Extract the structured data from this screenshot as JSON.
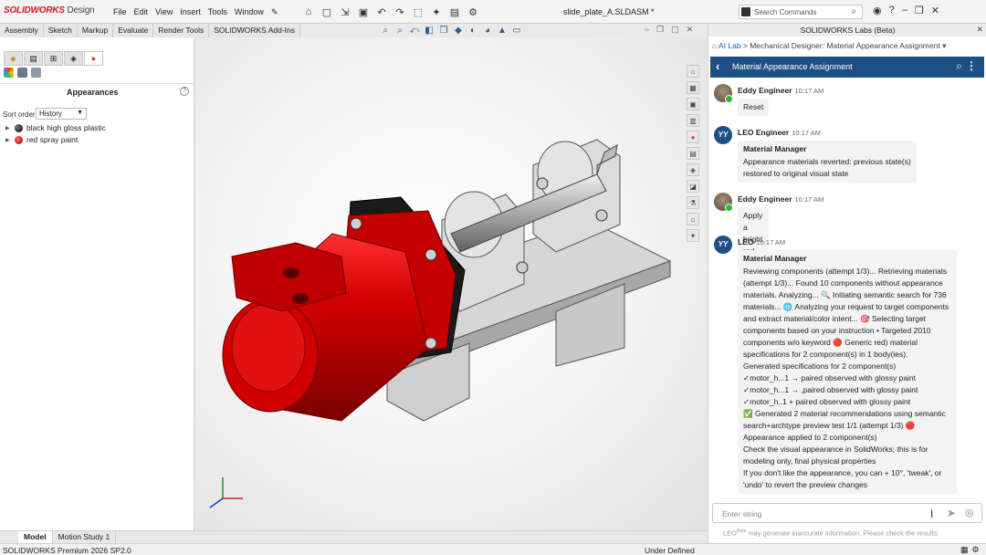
{
  "app": {
    "logo_brand": "SOLIDWORKS",
    "logo_product": "Design",
    "doc_title": "slide_plate_A.SLDASM *",
    "menu": [
      "File",
      "Edit",
      "View",
      "Insert",
      "Tools",
      "Window"
    ],
    "search_placeholder": "Search Commands"
  },
  "command_tabs": [
    "Assembly",
    "Sketch",
    "Markup",
    "Evaluate",
    "Render Tools",
    "SOLIDWORKS Add-Ins"
  ],
  "left_panel": {
    "title": "Appearances",
    "sort_label": "Sort order:",
    "sort_value": "History",
    "items": [
      {
        "label": "black high gloss plastic",
        "color": "#000000"
      },
      {
        "label": "red spray paint",
        "color": "#c00000"
      }
    ]
  },
  "bottom_tabs": [
    "Model",
    "Motion Study 1"
  ],
  "status": {
    "left": "SOLIDWORKS Premium 2026 SP2.0",
    "right": "Under Defined"
  },
  "right_panel": {
    "title": "SOLIDWORKS Labs (Beta)",
    "breadcrumb_root": "AI Lab",
    "breadcrumb_sep": ">",
    "breadcrumb_current": "Mechanical Designer: Material Appearance Assignment",
    "header_title": "Material Appearance Assignment",
    "messages": [
      {
        "author": "Eddy Engineer",
        "time": "10:17 AM",
        "text": "Reset"
      },
      {
        "author": "LEO Engineer",
        "time": "10:17 AM",
        "title": "Material Manager",
        "lines": [
          "Appearance materials reverted:  previous state(s)",
          "restored to original visual state"
        ]
      },
      {
        "author": "Eddy Engineer",
        "time": "10:17 AM",
        "text": "Apply a bright red paint color to the motor"
      },
      {
        "author": "LEO",
        "time": "10:17 AM",
        "title": "Material Manager",
        "lines": [
          "Reviewing components (attempt 1/3)... Retrieving materials",
          "(attempt 1/3)... Found 10 components without appearance",
          "materials. Analyzing... 🔍 Initiating semantic search for 736",
          "materials... 🌐 Analyzing your request to target components",
          "and extract material/color intent... 🎯 Selecting target",
          "components based on your instruction   • Targeted 2010",
          "components w/o keyword 🔴 Generic red) material",
          "specifications for 2 component(s) in 1 body(ies).",
          "Generated specifications for 2 component(s)",
          "✓motor_h...1     →    paired observed with glossy paint",
          "✓motor_h...1     →    ,paired observed with glossy paint",
          "✓motor_h..1 + paired observed with glossy paint",
          "✅ Generated 2 material recommendations using semantic",
          "search+archtype preview test 1/1 (attempt 1/3)   🔴",
          "Appearance applied to 2 component(s)",
          "Check the visual appearance in SolidWorks; this is for",
          "modeling only, final physical properties",
          "If you don't like the appearance, you can + 10°, 'tweak', or",
          "'undo' to revert the preview changes"
        ]
      }
    ],
    "input_placeholder": "Enter string",
    "disclaimer_name": "LEO",
    "disclaimer_sup": "Beta",
    "disclaimer_text": "may generate inaccurate information. Please check the results."
  },
  "colors": {
    "brand_red": "#d8161d",
    "header_blue": "#1f4f87",
    "motor_red": "#c40000"
  }
}
